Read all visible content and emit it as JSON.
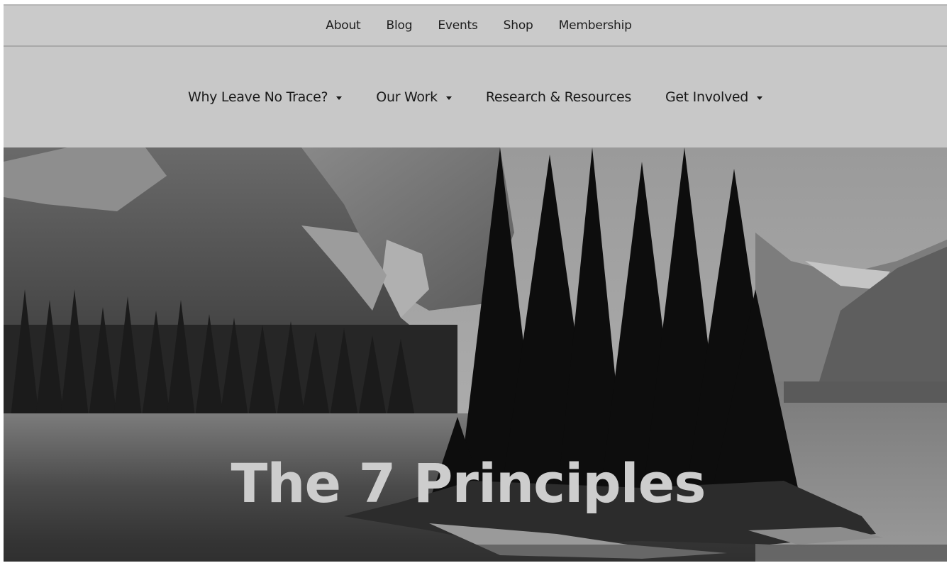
{
  "utility_nav": {
    "items": [
      "About",
      "Blog",
      "Events",
      "Shop",
      "Membership"
    ]
  },
  "main_nav": {
    "items": [
      {
        "label": "Why Leave No Trace?",
        "has_dropdown": true
      },
      {
        "label": "Our Work",
        "has_dropdown": true
      },
      {
        "label": "Research & Resources",
        "has_dropdown": false
      },
      {
        "label": "Get Involved",
        "has_dropdown": true
      }
    ]
  },
  "hero": {
    "title": "The 7 Principles"
  },
  "colors": {
    "nav_background": "#c9c9c9",
    "nav_text": "#1a1a1a",
    "hero_title": "#cdcdcd"
  }
}
